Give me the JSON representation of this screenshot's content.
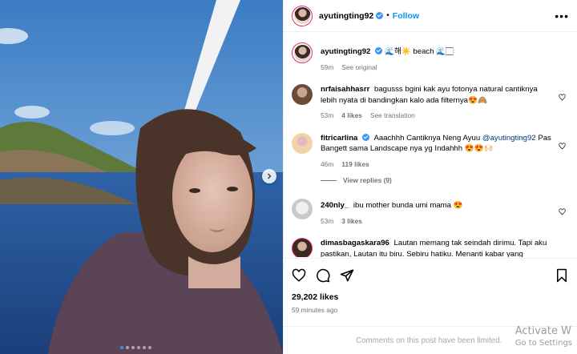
{
  "header": {
    "username": "ayutingting92",
    "separator": "•",
    "follow_label": "Follow",
    "more_icon": "more-horizontal-icon"
  },
  "caption": {
    "username": "ayutingting92",
    "text": "🌊해☀️ beach 🌊🏻",
    "time": "59m",
    "see_original": "See original"
  },
  "comments": [
    {
      "username": "nrfaisahhasrr",
      "text": "bagusss bgini kak ayu fotonya natural cantiknya lebih nyata di bandingkan kalo ada filternya😍🙈",
      "time": "53m",
      "likes": "4 likes",
      "extra": "See translation"
    },
    {
      "username": "fitricarlina",
      "text_before": "Aaachhh Cantiknya Neng Ayuu ",
      "mention": "@ayutingting92",
      "text_after": " Pas Bangett sama Landscape nya yg Indahhh 😍😍🙌🏻",
      "time": "46m",
      "likes": "119 likes",
      "view_replies": "View replies (9)"
    },
    {
      "username": "240nly_",
      "text": "ibu mother bunda umi mama 😍",
      "time": "53m",
      "likes": "3 likes"
    },
    {
      "username": "dimasbagaskara96",
      "text": "Lautan memang tak seindah dirimu. Tapi aku pastikan, Lautan itu biru. Sebiru hatiku. Menanti kabar yang"
    }
  ],
  "actions": {
    "likes": "29,202 likes",
    "ago": "59 minutes ago",
    "limited": "Comments on this post have been limited."
  },
  "watermark": {
    "line1": "Activate W",
    "line2": "Go to Settings"
  },
  "colors": {
    "accent": "#0095f6",
    "verified": "#3897f0",
    "muted": "#737373"
  }
}
